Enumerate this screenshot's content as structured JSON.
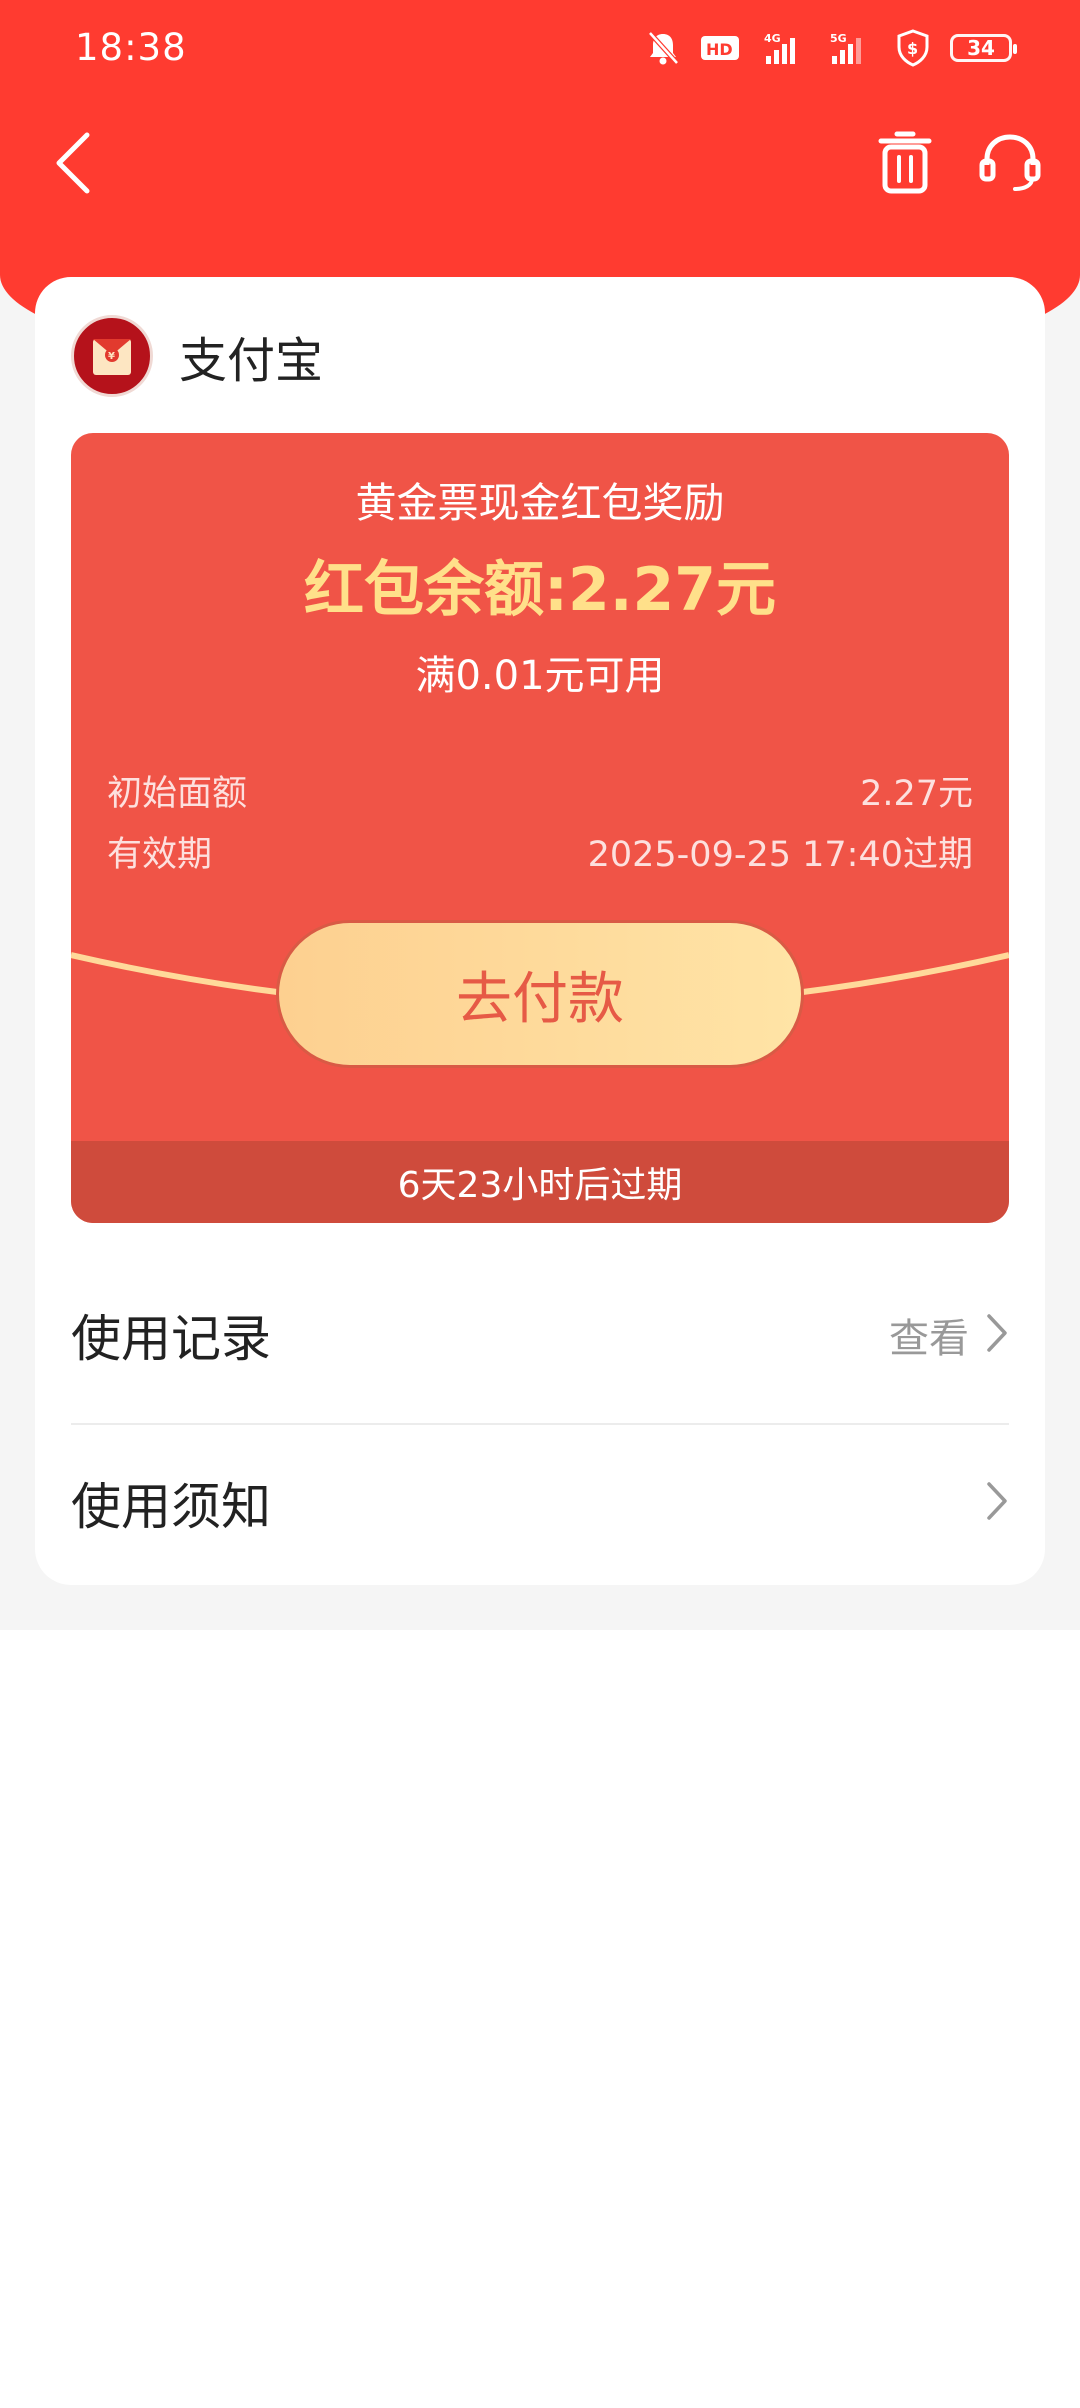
{
  "status_bar": {
    "time": "18:38",
    "battery": "34",
    "icons": [
      "mute-bell-icon",
      "hd-icon",
      "4g-signal-icon",
      "5g-signal-icon",
      "shield-dollar-icon",
      "battery-icon"
    ]
  },
  "nav": {
    "back_icon": "chevron-left-icon",
    "delete_icon": "trash-icon",
    "support_icon": "headset-icon"
  },
  "merchant": {
    "name": "支付宝"
  },
  "coupon": {
    "title": "黄金票现金红包奖励",
    "balance": "红包余额:2.27元",
    "condition": "满0.01元可用",
    "initial_label": "初始面额",
    "initial_value": "2.27元",
    "validity_label": "有效期",
    "validity_value": "2025-09-25 17:40过期",
    "pay_button": "去付款",
    "expiry_notice": "6天23小时后过期"
  },
  "rows": {
    "usage_record": {
      "label": "使用记录",
      "action": "查看"
    },
    "usage_notice": {
      "label": "使用须知"
    }
  },
  "colors": {
    "brand_red": "#ff3b30",
    "coupon_red": "#f05447",
    "gold_text": "#ffe08a"
  }
}
